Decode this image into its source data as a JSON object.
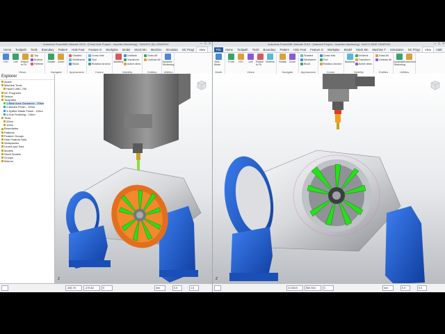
{
  "colors": {
    "accent": "#2a5c9a",
    "blade_green": "#27e01a",
    "fixture_blue": "#1d5fd1",
    "stock_orange": "#f08a2a"
  },
  "left": {
    "window_title": "Autodesk PowerMill Ultimate 2019 · [Fixed Axis Project - Impeller Machining] · IMAGES (III) GRAPHIC",
    "tabs": [
      "Home",
      "Toolpath",
      "Tools",
      "Boundary",
      "Pattern",
      "Hole Feat",
      "Feature G",
      "Workplan",
      "Model",
      "Stock Mo",
      "Machine",
      "Simulatio",
      "NC Progr",
      "View"
    ],
    "active_tab": "View",
    "ribbon": {
      "groups": [
        {
          "label": "Views",
          "big": [
            "ISO",
            "Left",
            "Resize to Fit"
          ],
          "small": [
            "Top",
            "Bottom",
            "Refresh"
          ]
        },
        {
          "label": "Navigate",
          "big": [
            "Rotate",
            "Zoom"
          ],
          "small": []
        },
        {
          "label": "Appearance",
          "big": [],
          "small": [
            "Shaded",
            "Wireframe",
            "Block"
          ]
        },
        {
          "label": "Cursor",
          "big": [],
          "small": [
            "Cross Hair",
            "Tool",
            "Rotation Anchor"
          ]
        },
        {
          "label": "Visibility",
          "big": [
            "Blanking"
          ],
          "small": [
            "Unblank",
            "Transform",
            "Active dims"
          ]
        },
        {
          "label": "Entities",
          "big": [],
          "small": [
            "Draw All",
            "Undraw All"
          ]
        },
        {
          "label": "Utilities",
          "big": [
            "Dynamic Sectioning"
          ],
          "small": []
        }
      ]
    },
    "explorer": {
      "title": "Explorer",
      "items": [
        "Active",
        "Machine Tools",
        "HAAS UMC-750",
        "NC Programs",
        "Setups",
        "Toolpaths",
        "1-Blisk Area Clearance - 20hm",
        "2-Blades Finish - 10hm",
        "3-Splitter Blade Finish - 10hm",
        "4-Hub Finishing - 10hm",
        "Tools",
        "20hm",
        "10hm",
        "Boundaries",
        "Patterns",
        "Feature Groups",
        "Hole Feature Sets",
        "Workplanes",
        "Levels and Sets",
        "Models",
        "Stock Models",
        "Groups",
        "Macros"
      ]
    },
    "status": {
      "x": "-456.76",
      "y": "-476.62",
      "z": "0",
      "units": "mm",
      "tol": "0.5",
      "stepover": "1.5"
    },
    "axis_label": "Z"
  },
  "right": {
    "window_title": "Autodesk PowerMill Ultimate 2019 · [Indexed Project - Impeller Machining] · MULTI-SIDE GRAPHIC",
    "tabs": [
      "File",
      "Home",
      "Toolpath",
      "Tools",
      "Boundary",
      "Pattern",
      "Hole Feat",
      "Feature G",
      "Workplan",
      "Model",
      "Stock Mo",
      "Machine T",
      "Simulation",
      "NC Progr",
      "View",
      "Addi"
    ],
    "active_tab": "View",
    "ribbon": {
      "groups": [
        {
          "label": "Mode",
          "big": [
            "View Mode"
          ],
          "small": []
        },
        {
          "label": "Views",
          "big": [
            "Front",
            "ISO",
            "Left",
            "Resize to Fit",
            "Refresh"
          ],
          "small": []
        },
        {
          "label": "Navigate",
          "big": [
            "Rotate",
            "Zoom"
          ],
          "small": []
        },
        {
          "label": "Appearance",
          "big": [],
          "small": [
            "Shaded",
            "Wireframe",
            "Block"
          ]
        },
        {
          "label": "Cursor",
          "big": [],
          "small": [
            "Cross Hair",
            "Tool",
            "Rotation Anchor"
          ]
        },
        {
          "label": "Visibility",
          "big": [
            "Blanking"
          ],
          "small": [
            "Unblank",
            "Transform",
            "Active dims"
          ]
        },
        {
          "label": "Entities",
          "big": [],
          "small": [
            "Draw All",
            "Undraw All"
          ]
        },
        {
          "label": "Utilities",
          "big": [
            "Dynamic Sectioning",
            "Screenshot"
          ],
          "small": []
        }
      ]
    },
    "status": {
      "x": "21.5615",
      "y": "564.944",
      "z": "0",
      "units": "mm",
      "tol": "0.5",
      "stepover": "0.0"
    },
    "axis_label": "Z"
  }
}
